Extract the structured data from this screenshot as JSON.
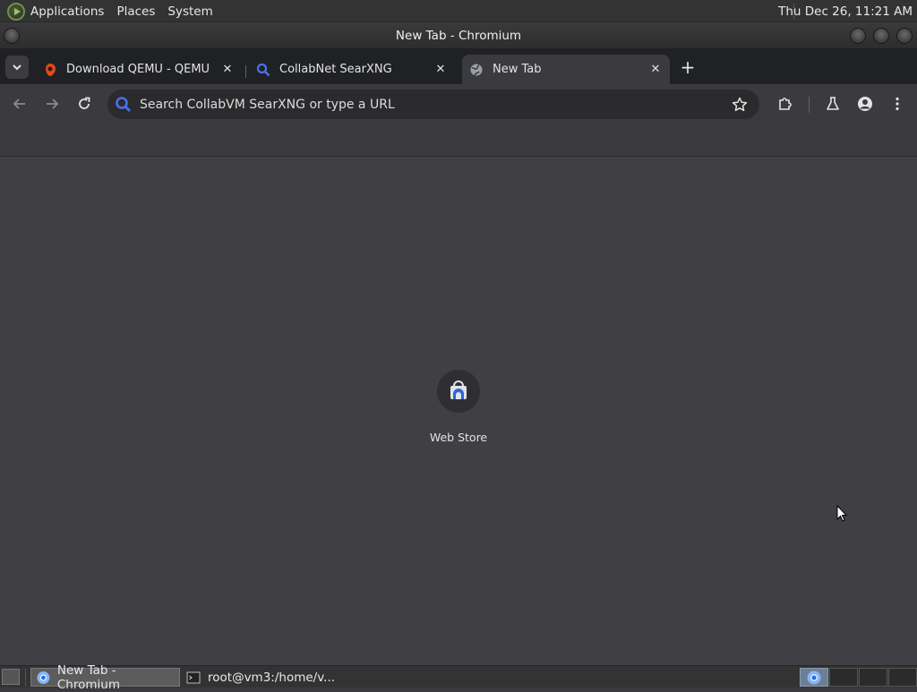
{
  "top_panel": {
    "menus": [
      "Applications",
      "Places",
      "System"
    ],
    "clock": "Thu Dec 26, 11:21 AM"
  },
  "window": {
    "title": "New Tab - Chromium"
  },
  "tabs": [
    {
      "label": "Download QEMU - QEMU",
      "favicon": "qemu-icon",
      "active": false
    },
    {
      "label": "CollabNet SearXNG",
      "favicon": "search-icon",
      "active": false
    },
    {
      "label": "New Tab",
      "favicon": "globe-icon",
      "active": true
    }
  ],
  "omnibox": {
    "placeholder": "Search CollabVM SearXNG or type a URL"
  },
  "shortcuts": [
    {
      "name": "Web Store",
      "icon": "web-store-icon"
    }
  ],
  "taskbar": {
    "tasks": [
      {
        "label": "New Tab - Chromium",
        "icon": "chromium-icon",
        "active": true
      },
      {
        "label": "root@vm3:/home/v...",
        "icon": "terminal-icon",
        "active": false
      }
    ]
  },
  "colors": {
    "panel": "#333333",
    "tabstrip": "#202124",
    "toolbar": "#3b3b3f",
    "content": "#3f3f44",
    "omnibox": "#2b2b2e",
    "accent_blue": "#4a6ff0"
  }
}
